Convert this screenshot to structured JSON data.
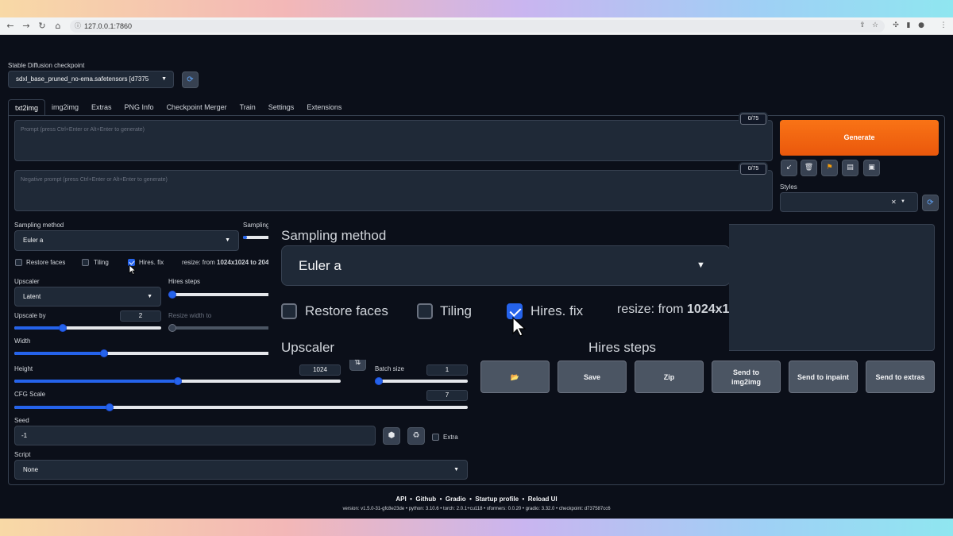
{
  "browser": {
    "url": "127.0.0.1:7860"
  },
  "header": {
    "checkpoint_label": "Stable Diffusion checkpoint",
    "checkpoint_value": "sdxl_base_pruned_no-ema.safetensors [d7375"
  },
  "tabs": [
    "txt2img",
    "img2img",
    "Extras",
    "PNG Info",
    "Checkpoint Merger",
    "Train",
    "Settings",
    "Extensions"
  ],
  "prompt": {
    "placeholder": "Prompt (press Ctrl+Enter or Alt+Enter to generate)",
    "counter": "0/75"
  },
  "negative_prompt": {
    "placeholder": "Negative prompt (press Ctrl+Enter or Alt+Enter to generate)",
    "counter": "0/75"
  },
  "actions": {
    "generate": "Generate",
    "styles_label": "Styles"
  },
  "settings": {
    "sampling_method_label": "Sampling method",
    "sampling_method_value": "Euler a",
    "sampling_steps_label": "Sampling steps",
    "restore_faces": "Restore faces",
    "tiling": "Tiling",
    "hires_fix": "Hires. fix",
    "resize_prefix": "resize: from ",
    "resize_value": "1024x1024 to 204",
    "upscaler_label": "Upscaler",
    "upscaler_value": "Latent",
    "hires_steps_label": "Hires steps",
    "upscale_by_label": "Upscale by",
    "upscale_by_value": "2",
    "resize_width_label": "Resize width to",
    "width_label": "Width",
    "height_label": "Height",
    "height_value": "1024",
    "batch_size_label": "Batch size",
    "batch_size_value": "1",
    "cfg_label": "CFG Scale",
    "cfg_value": "7",
    "seed_label": "Seed",
    "seed_value": "-1",
    "extra_label": "Extra",
    "script_label": "Script",
    "script_value": "None"
  },
  "zoom": {
    "sampling_method_label": "Sampling method",
    "sampling_method_value": "Euler a",
    "restore_faces": "Restore faces",
    "tiling": "Tiling",
    "hires_fix": "Hires. fix",
    "resize_prefix": "resize: from ",
    "resize_value": "1024x1",
    "upscaler_label": "Upscaler",
    "hires_steps_label": "Hires steps"
  },
  "output_buttons": {
    "folder": "📂",
    "save": "Save",
    "zip": "Zip",
    "send_img2img_1": "Send to",
    "send_img2img_2": "img2img",
    "send_inpaint": "Send to inpaint",
    "send_extras": "Send to extras"
  },
  "footer": {
    "api": "API",
    "github": "Github",
    "gradio": "Gradio",
    "startup": "Startup profile",
    "reload": "Reload UI",
    "version": "version: v1.5.0-31-gfc8e23de  •  python: 3.10.6  •  torch: 2.0.1+cu118  •  xformers: 0.0.20  •  gradio: 3.32.0  •  checkpoint: d737587cc6"
  },
  "sliders": {
    "sampling_steps": 0.1,
    "hires_steps": 0.0,
    "upscale_by": 0.33,
    "width": 0.35,
    "height": 0.5,
    "batch_size": 0.02,
    "cfg_scale": 0.21
  },
  "colors": {
    "accent": "#2563eb",
    "generate": "#f97316",
    "background": "#0b0f19"
  }
}
